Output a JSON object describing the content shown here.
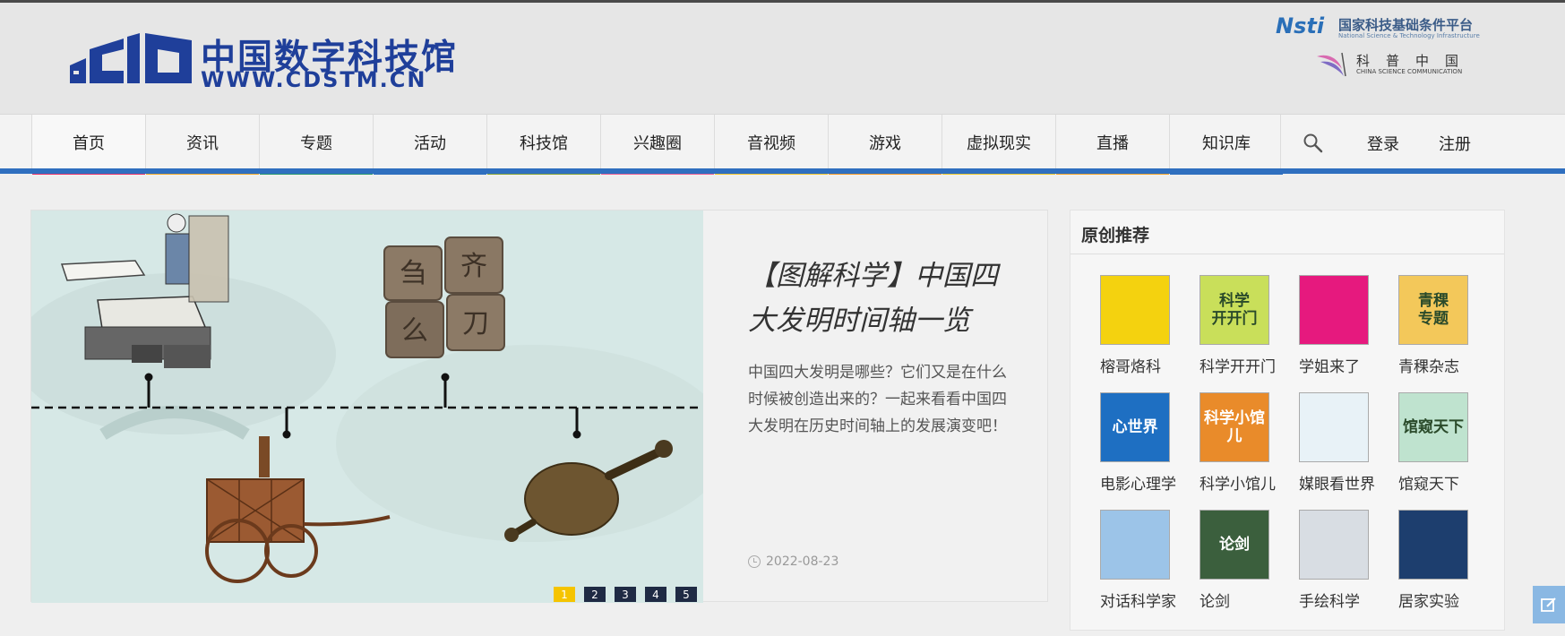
{
  "logo": {
    "cn": "中国数字科技馆",
    "en": "WWW.CDSTM.CN"
  },
  "partners": {
    "nsti": {
      "mark": "Nsti",
      "cn": "国家科技基础条件平台",
      "en": "National Science & Technology Infrastructure"
    },
    "kepu": {
      "cn": "科普中国",
      "en": "CHINA SCIENCE COMMUNICATION"
    }
  },
  "nav": {
    "items": [
      {
        "label": "首页",
        "color": "#e8346a"
      },
      {
        "label": "资讯",
        "color": "#f0a929"
      },
      {
        "label": "专题",
        "color": "#2a9a6e"
      },
      {
        "label": "活动",
        "color": "#2f6fbf"
      },
      {
        "label": "科技馆",
        "color": "#85a335"
      },
      {
        "label": "兴趣圈",
        "color": "#ec5f93"
      },
      {
        "label": "音视频",
        "color": "#f2c52b"
      },
      {
        "label": "游戏",
        "color": "#f49a26"
      },
      {
        "label": "虚拟现实",
        "color": "#ecc82a"
      },
      {
        "label": "直播",
        "color": "#f2a42a"
      },
      {
        "label": "知识库",
        "color": "#2f6fbf"
      }
    ],
    "login": "登录",
    "register": "注册"
  },
  "feature": {
    "title": "【图解科学】中国四大发明时间轴一览",
    "desc": "中国四大发明是哪些？它们又是在什么时候被创造出来的？一起来看看中国四大发明在历史时间轴上的发展演变吧！",
    "date": "2022-08-23",
    "block_chars": [
      "刍",
      "齐",
      "么",
      "刀"
    ],
    "pages": [
      "1",
      "2",
      "3",
      "4",
      "5"
    ]
  },
  "recommend": {
    "title": "原创推荐",
    "items": [
      {
        "label": "榕哥烙科",
        "thumb": "",
        "bg": "#f4d20f"
      },
      {
        "label": "科学开开门",
        "thumb": "科学\n开开门",
        "bg": "#c9df5a"
      },
      {
        "label": "学姐来了",
        "thumb": "",
        "bg": "#e6197e"
      },
      {
        "label": "青稞杂志",
        "thumb": "青稞\n专题",
        "bg": "#f3c85a"
      },
      {
        "label": "电影心理学",
        "thumb": "心世界",
        "bg": "#1e6fc2"
      },
      {
        "label": "科学小馆儿",
        "thumb": "科学小馆儿",
        "bg": "#e98b2a"
      },
      {
        "label": "媒眼看世界",
        "thumb": "",
        "bg": "#e8f2f7"
      },
      {
        "label": "馆窥天下",
        "thumb": "馆窥天下",
        "bg": "#bfe3cf"
      },
      {
        "label": "对话科学家",
        "thumb": "",
        "bg": "#9cc4e8"
      },
      {
        "label": "论剑",
        "thumb": "论剑",
        "bg": "#3b5f3d"
      },
      {
        "label": "手绘科学",
        "thumb": "",
        "bg": "#d8dde3"
      },
      {
        "label": "居家实验",
        "thumb": "",
        "bg": "#1d3e6e"
      }
    ]
  }
}
